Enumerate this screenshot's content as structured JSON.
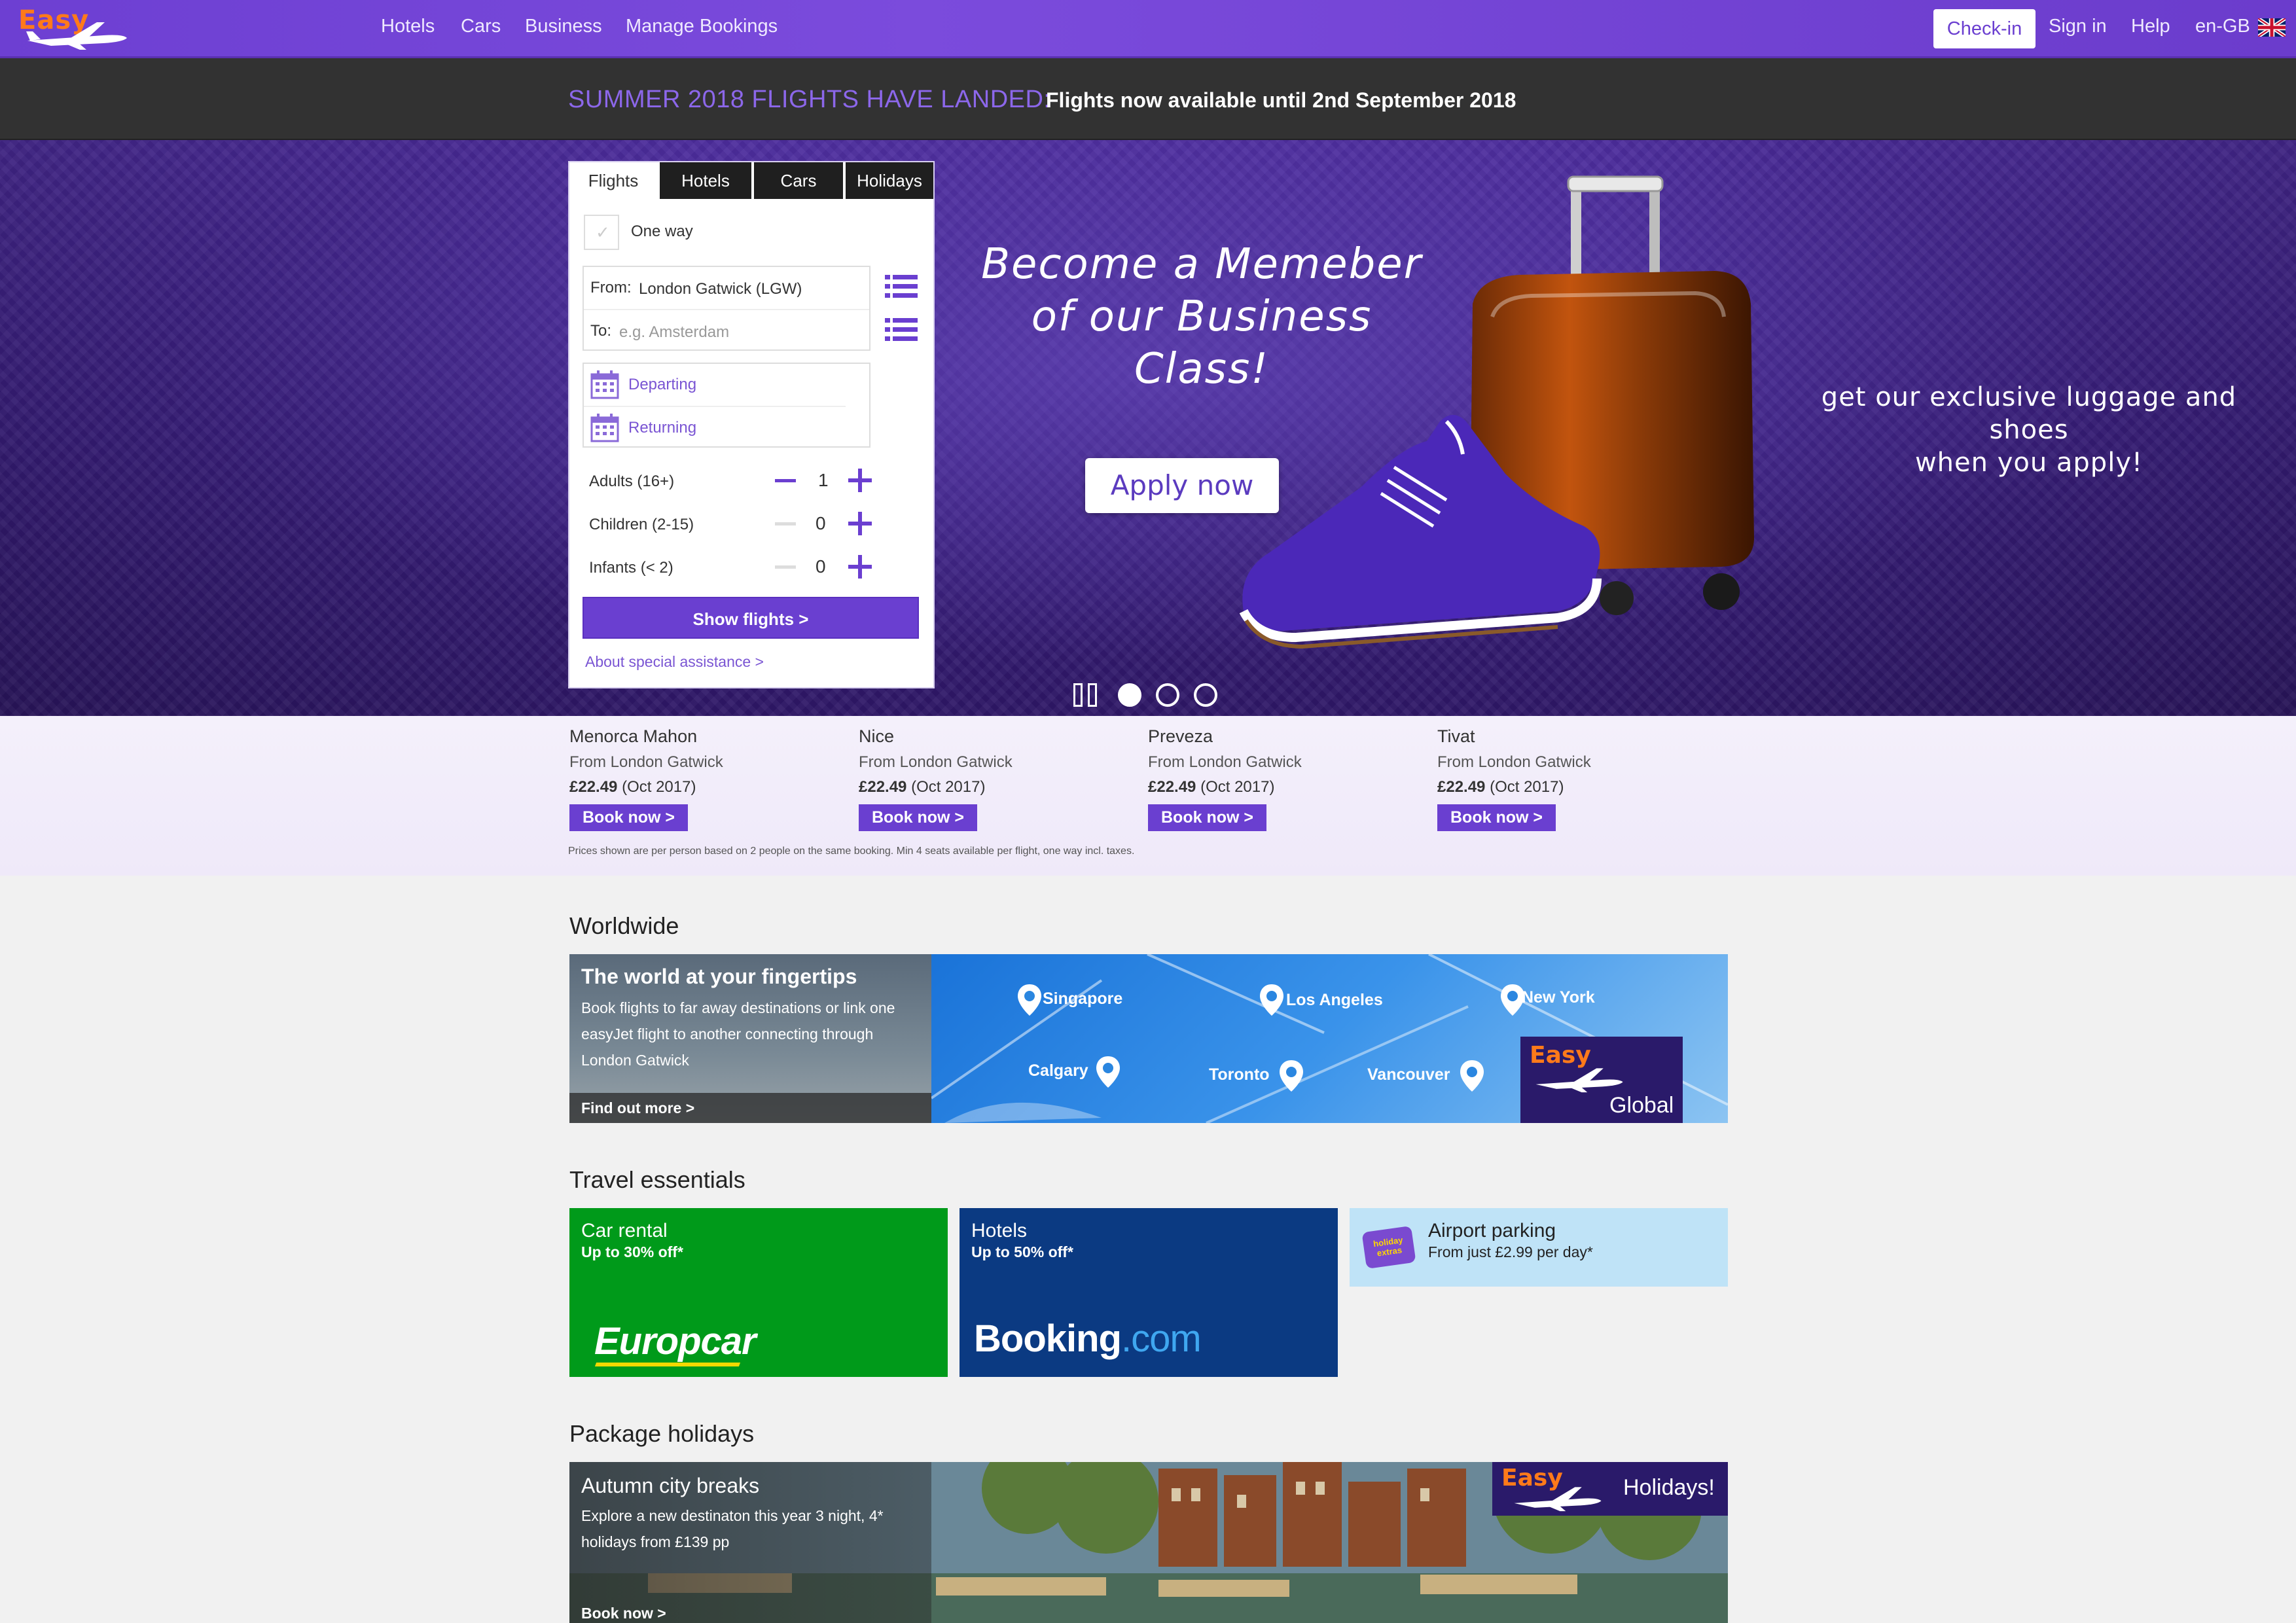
{
  "nav": {
    "logo": "Easy",
    "links": [
      "Hotels",
      "Cars",
      "Business",
      "Manage Bookings"
    ],
    "checkin": "Check-in",
    "signin": "Sign in",
    "help": "Help",
    "lang": "en-GB"
  },
  "banner": {
    "highlight": "SUMMER 2018 FLIGHTS HAVE LANDED:",
    "text": "Flights now available until 2nd September 2018"
  },
  "hero": {
    "title_line1": "Become a Memeber",
    "title_line2": "of our Business Class!",
    "apply": "Apply now",
    "sub_line1": "get our exclusive luggage and shoes",
    "sub_line2": "when you apply!"
  },
  "search": {
    "tabs": [
      "Flights",
      "Hotels",
      "Cars",
      "Holidays"
    ],
    "one_way": "One way",
    "from_label": "From:",
    "from_value": "London Gatwick (LGW)",
    "to_label": "To:",
    "to_placeholder": "e.g. Amsterdam",
    "departing": "Departing",
    "returning": "Returning",
    "adults_label": "Adults (16+)",
    "adults": "1",
    "children_label": "Children (2-15)",
    "children": "0",
    "infants_label": "Infants (< 2)",
    "infants": "0",
    "show_flights": "Show flights >",
    "assistance": "About special assistance >"
  },
  "deals": [
    {
      "city": "Menorca Mahon",
      "from": "From London Gatwick",
      "price": "£22.49",
      "when": "(Oct 2017)",
      "cta": "Book now >"
    },
    {
      "city": "Nice",
      "from": "From London Gatwick",
      "price": "£22.49",
      "when": "(Oct 2017)",
      "cta": "Book now >"
    },
    {
      "city": "Preveza",
      "from": "From London Gatwick",
      "price": "£22.49",
      "when": "(Oct 2017)",
      "cta": "Book now >"
    },
    {
      "city": "Tivat",
      "from": "From London Gatwick",
      "price": "£22.49",
      "when": "(Oct 2017)",
      "cta": "Book now >"
    }
  ],
  "deals_fineprint": "Prices shown are per person based on 2 people on the same booking. Min 4 seats available per flight, one way incl. taxes.",
  "worldwide": {
    "section_title": "Worldwide",
    "heading": "The world at your fingertips",
    "body": "Book flights to far away destinations or link one easyJet flight to another connecting through London Gatwick",
    "cta": "Find out more >",
    "cities": [
      "Singapore",
      "Los Angeles",
      "New York",
      "Calgary",
      "Toronto",
      "Vancouver"
    ],
    "badge_logo": "Easy",
    "badge_text": "Global"
  },
  "essentials": {
    "section_title": "Travel essentials",
    "car": {
      "title": "Car rental",
      "offer": "Up to 30% off*",
      "brand": "Europcar"
    },
    "hotels": {
      "title": "Hotels",
      "offer": "Up to 50% off*",
      "brand_a": "Booking",
      "brand_b": ".com"
    },
    "parking": {
      "title": "Airport parking",
      "offer": "From just £2.99 per day*",
      "badge": "holiday extras"
    }
  },
  "package": {
    "section_title": "Package holidays",
    "heading": "Autumn city breaks",
    "body": "Explore a new destinaton this year 3 night, 4* holidays from £139 pp",
    "cta": "Book now >",
    "badge_logo": "Easy",
    "badge_text": "Holidays!"
  },
  "colors": {
    "brand_purple": "#6a3fd0",
    "logo_orange": "#ff7a1a",
    "europcar_green": "#009a1a",
    "booking_blue": "#0b3a82",
    "parking_blue": "#bfe3f7"
  }
}
